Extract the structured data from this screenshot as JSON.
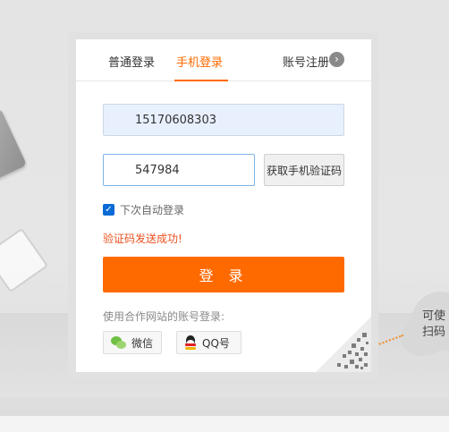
{
  "tabs": {
    "normal_login": "普通登录",
    "phone_login": "手机登录",
    "register": "账号注册"
  },
  "form": {
    "phone_value": "15170608303",
    "code_value": "547984",
    "get_code_button": "获取手机验证码",
    "remember_label": "下次自动登录",
    "remember_checked": true,
    "success_message": "验证码发送成功!",
    "login_button": "登 录"
  },
  "partner": {
    "label": "使用合作网站的账号登录:",
    "wechat": "微信",
    "qq": "QQ号"
  },
  "side_hint": {
    "line1": "可使",
    "line2": "扫码"
  },
  "colors": {
    "accent": "#ff6a00",
    "success_text": "#e8511f",
    "checkbox": "#0b6bd6"
  },
  "icons": {
    "register_arrow": "chevron-right-icon",
    "wechat": "wechat-icon",
    "qq": "qq-penguin-icon",
    "qr": "qr-code-icon"
  }
}
